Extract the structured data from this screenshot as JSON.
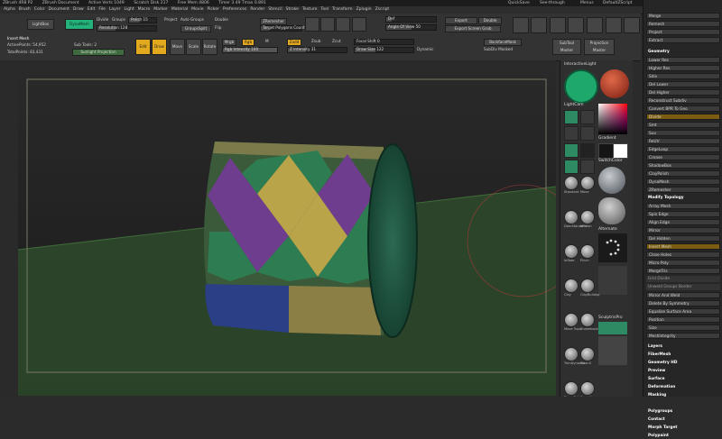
{
  "title_bar": {
    "app": "ZBrush 4R8 P2",
    "document": "ZBrush Document",
    "active_points": "Active Verts 1049",
    "scratch_disk": "Scratch Disk 217",
    "free_mem": "Free Mem 4806",
    "timer": "Timer 3.49 Tmax 0.891",
    "quicksave": "QuickSave",
    "see_through": "See-through",
    "menus": "Menus",
    "script": "DefaultZScript"
  },
  "menu": [
    "Alpha",
    "Brush",
    "Color",
    "Document",
    "Draw",
    "Edit",
    "File",
    "Layer",
    "Light",
    "Macro",
    "Marker",
    "Material",
    "Movie",
    "Picker",
    "Preferences",
    "Render",
    "Stencil",
    "Stroke",
    "Texture",
    "Tool",
    "Transform",
    "Zplugin",
    "Zscript"
  ],
  "toolbar": {
    "lightbox": "LightBox",
    "dynamesh": "DynaMesh",
    "divide": "Divide",
    "groups": "Groups",
    "polish": "Polish",
    "polish_val": "15",
    "resolution": "Resolution",
    "resolution_val": "128",
    "project": "Project",
    "auto_groups": "Auto Groups",
    "double": "Double",
    "groupsplit": "GroupsSplit",
    "flip": "Flip",
    "uv": "UV",
    "zremesher": "ZRemesher",
    "target": "Target Polygons Count",
    "target_val": "5",
    "def": "Def",
    "angle": "Angle Of View",
    "angle_val": "50",
    "export": "Export",
    "export_screen": "Export Screen Grab",
    "double2": "Double",
    "insert_mesh": "Insert Mesh",
    "active_points": "ActivePoints: 54,952",
    "total_points": "TotalPoints: 83,431",
    "sub_tools": "Sub Tools: 2",
    "sunlight": "Sunlight Projection",
    "edit": "Edit",
    "draw": "Draw",
    "move": "Move",
    "scale": "Scale",
    "rotate": "Rotate",
    "mrgb": "Mrgb",
    "rgb": "Rgb",
    "m": "M",
    "zadd": "Zadd",
    "zsub": "Zsub",
    "zcut": "Zcut",
    "rgb_intensity": "Rgb Intensity 100",
    "z_intensity": "Z Intensity 31",
    "focal_shift": "Focal Shift 0",
    "draw_size": "Draw Size 122",
    "dynamic": "Dynamic",
    "backface": "BackfaceMask",
    "subdiv": "SubDiv Masked",
    "subtool_master": "SubTool Master",
    "projection_master": "Projection Master"
  },
  "shelf": {
    "interactive_light": "InteractiveLight",
    "lightcam": "LightCam",
    "gradient": "Gradient",
    "switchcolor": "SwitchColor",
    "alternate": "Alternate",
    "brushes": [
      "Standard",
      "Move",
      "DamStandard",
      "hPolish",
      "Inflate",
      "Pinch",
      "Clay",
      "ClayBuildup",
      "Move Topo",
      "Snakehook",
      "TrimDynamic",
      "Slash3",
      "Dam_Std",
      "Smooth",
      "CurveTube",
      "Orb_Flatten"
    ],
    "sculptris": "SculptrisPro",
    "dots": "Dots",
    "spotlight": "Spotlight",
    "stroke": "Stroke"
  },
  "right_panel": {
    "top_items": [
      "Merge",
      "Remesh",
      "Project",
      "Extract"
    ],
    "geometry": "Geometry",
    "geo_items": [
      "Lower Res",
      "Higher Res",
      "Sdiv",
      "Del Lower",
      "Del Higher",
      "Reconstruct Subdiv",
      "Convert BPR To Geo",
      "Divide",
      "Smt",
      "Suv",
      "ReUV"
    ],
    "edgeloop": "EdgeLoop",
    "crease": "Crease",
    "shadowbox": "ShadowBox",
    "claypolish": "ClayPolish",
    "dynamesh": "DynaMesh",
    "zremesher": "ZRemesher",
    "modify_topology": "Modify Topology",
    "topo_items": [
      "Array Mesh",
      "Spin Edge",
      "Align Edge",
      "Mirror",
      "Del Hidden",
      "Insert Mesh",
      "Close Holes",
      "Micro Poly",
      "MergeTris",
      "Grid Divide",
      "Unweld Groups Border",
      "Mirror And Weld",
      "Delete By Symmetry",
      "Equalize Surface Area"
    ],
    "other_items": [
      "Position",
      "Size",
      "MeshIntegrity"
    ],
    "sections": [
      "Layers",
      "FiberMesh",
      "Geometry HD",
      "Preview",
      "Surface",
      "Deformation",
      "Masking",
      "Visibility",
      "Polygroups",
      "Contact",
      "Morph Target",
      "Polypaint"
    ]
  },
  "viewport": {
    "floor_color": "#2e4a2c",
    "model_colors": [
      "#5e2f7c",
      "#b5a64a",
      "#2d7a4d",
      "#2a3c7a",
      "#1b5e45"
    ]
  }
}
